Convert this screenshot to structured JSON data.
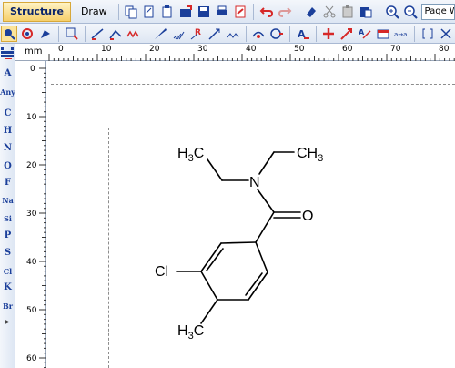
{
  "toolbar": {
    "tabs": [
      {
        "label": "Structure",
        "active": true
      },
      {
        "label": "Draw",
        "active": false
      }
    ],
    "zoom_value": "Page Wi",
    "icons_row1": [
      "copy-icon",
      "cut-page-icon",
      "paste-page-icon",
      "open-icon",
      "save-icon",
      "print-icon",
      "pdf-icon",
      "undo-icon",
      "redo-icon",
      "eraser-icon",
      "scissors-icon",
      "clipboard-icon",
      "paste-icon",
      "zoom-in-icon",
      "zoom-out-icon"
    ],
    "icons_row2": [
      "lasso-select-icon",
      "rotate-icon",
      "clean-icon",
      "rect-select-icon",
      "single-bond-icon",
      "chain-icon",
      "wavy-chain-icon",
      "wedge-bond-icon",
      "hash-bond-icon",
      "r-group-icon",
      "arrow-bond-icon",
      "zigzag-icon",
      "ring-icon",
      "ring-settings-icon",
      "text-icon",
      "plus-icon",
      "reaction-arrow-icon",
      "atom-map-icon",
      "table-icon",
      "a-to-a-icon",
      "bracket-icon",
      "expand-icon"
    ]
  },
  "palette": {
    "atoms": [
      "A",
      "Any",
      "C",
      "H",
      "N",
      "O",
      "F",
      "Na",
      "Si",
      "P",
      "S",
      "Cl",
      "K",
      "Br"
    ]
  },
  "ruler": {
    "unit": "mm",
    "h_labels": [
      "0",
      "10",
      "20",
      "30",
      "40",
      "50",
      "60",
      "70",
      "80"
    ],
    "v_labels": [
      "0",
      "10",
      "20",
      "30",
      "40",
      "50",
      "60"
    ]
  },
  "molecule": {
    "atom_labels": {
      "ethyl_left": {
        "main": "H",
        "sub": "3",
        "tail": "C"
      },
      "ethyl_right": {
        "main": "CH",
        "sub": "3"
      },
      "nitrogen": "N",
      "oxygen": "O",
      "chlorine": "Cl",
      "methyl": {
        "main": "H",
        "sub": "3",
        "tail": "C"
      }
    }
  },
  "colors": {
    "accent": "#1b3f9a",
    "active_tab": "#f6cf6b",
    "toolbar_bg": "#dde6f3",
    "bond": "#000000"
  }
}
